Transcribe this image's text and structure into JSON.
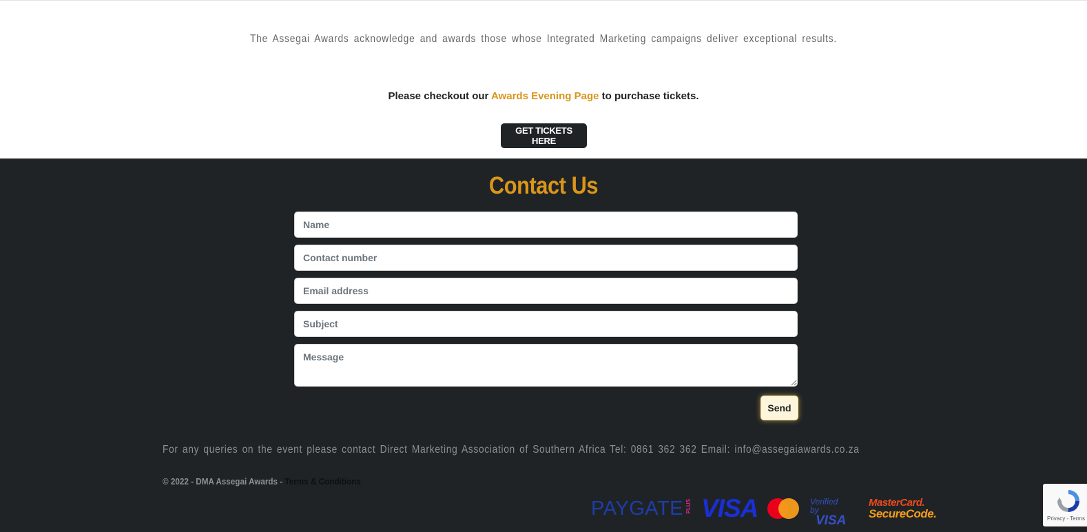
{
  "intro": {
    "text": "The Assegai Awards acknowledge and awards those whose Integrated Marketing campaigns deliver exceptional results."
  },
  "checkout": {
    "before": "Please checkout our ",
    "link": "Awards Evening Page",
    "after": " to purchase tickets."
  },
  "tickets_button": "GET TICKETS HERE",
  "contact": {
    "title": "Contact Us",
    "fields": {
      "name": "Name",
      "contact_number": "Contact number",
      "email": "Email address",
      "subject": "Subject",
      "message": "Message"
    },
    "send_label": "Send"
  },
  "footer": {
    "queries": "For any queries on the event please contact Direct Marketing Association of Southern Africa Tel: 0861 362 362 Email: info@assegaiawards.co.za",
    "copyright": "© 2022 - DMA Assegai Awards - ",
    "terms": "Terms & Conditions"
  },
  "payment_logos": {
    "paygate": "PAYGATE",
    "paygate_plus": "PLUS",
    "visa": "VISA",
    "verified_by": "Verified by",
    "verified_visa": "VISA",
    "mastercard": "MasterCard.",
    "securecode": "SecureCode."
  },
  "recaptcha": {
    "links": "Privacy - Terms"
  },
  "colors": {
    "accent": "#d9961a",
    "dark_bg": "#1f2326",
    "muted_text": "#8c9094"
  }
}
